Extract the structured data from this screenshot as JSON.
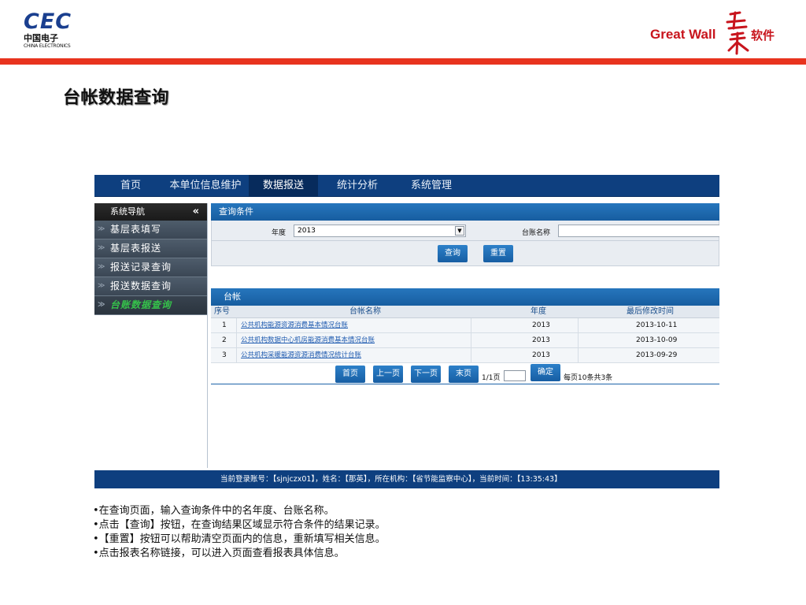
{
  "header": {
    "cec_main": "CEC",
    "cec_cn": "中国电子",
    "cec_en": "CHINA ELECTRONICS",
    "gw_text": "Great Wall",
    "gw_soft": "软件",
    "colors": {
      "accent_red": "#e8331e",
      "nav_blue": "#0e3f7f",
      "cec_blue": "#1a3f8f"
    }
  },
  "slide_title": "台帐数据查询",
  "app": {
    "nav": [
      {
        "label": "首页",
        "active": false
      },
      {
        "label": "本单位信息维护",
        "active": false
      },
      {
        "label": "数据报送",
        "active": true
      },
      {
        "label": "统计分析",
        "active": false
      },
      {
        "label": "系统管理",
        "active": false
      }
    ],
    "sidebar": {
      "title": "系统导航",
      "collapse": "«",
      "items": [
        {
          "label": "基层表填写",
          "active": false
        },
        {
          "label": "基层表报送",
          "active": false
        },
        {
          "label": "报送记录查询",
          "active": false
        },
        {
          "label": "报送数据查询",
          "active": false
        },
        {
          "label": "台账数据查询",
          "active": true
        }
      ]
    },
    "query": {
      "title": "查询条件",
      "year_label": "年度",
      "year_value": "2013",
      "name_label": "台账名称",
      "name_value": "",
      "search_button": "查询",
      "reset_button": "重置"
    },
    "ledger": {
      "title": "台帐",
      "columns": [
        "序号",
        "台帐名称",
        "年度",
        "最后修改时间"
      ],
      "rows": [
        {
          "no": "1",
          "name": "公共机构能源资源消费基本情况台账",
          "year": "2013",
          "modified": "2013-10-11"
        },
        {
          "no": "2",
          "name": "公共机构数据中心机房能源消费基本情况台账",
          "year": "2013",
          "modified": "2013-10-09"
        },
        {
          "no": "3",
          "name": "公共机构采暖能源资源消费情况统计台账",
          "year": "2013",
          "modified": "2013-09-29"
        }
      ],
      "pager": {
        "first": "首页",
        "prev": "上一页",
        "next": "下一页",
        "last": "末页",
        "page_info": "1/1页",
        "page_value": "",
        "confirm": "确定",
        "summary": "每页10条共3条"
      }
    },
    "status": "当前登录账号：【sjnjczx01】，姓名：【那英】，所在机构：【省节能监察中心】，当前时间：【13:35:43】"
  },
  "notes": [
    "•在查询页面，输入查询条件中的名年度、台账名称。",
    "•点击【查询】按钮，在查询结果区域显示符合条件的结果记录。",
    "•【重置】按钮可以帮助清空页面内的信息，重新填写相关信息。",
    "•点击报表名称链接，可以进入页面查看报表具体信息。"
  ]
}
